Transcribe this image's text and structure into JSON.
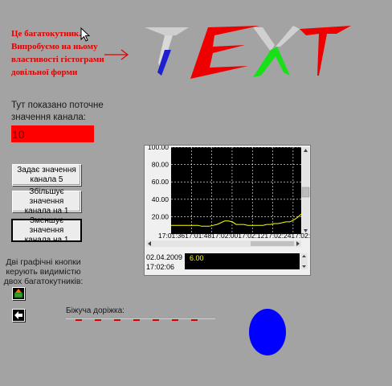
{
  "note": {
    "lines": [
      "Це багатокутник.",
      "Випробуємо на ньому",
      "властивості гістограми",
      "довільної форми"
    ],
    "color": "#e00000"
  },
  "current_value": {
    "label_lines": [
      "Тут показано поточне",
      "значення канала:"
    ],
    "value": "10"
  },
  "buttons": [
    {
      "lines": [
        "Задає значення",
        "канала 5"
      ]
    },
    {
      "lines": [
        "Збільшує значення",
        "канала на 1"
      ]
    },
    {
      "lines": [
        "Зменшує значення",
        "канала на 1"
      ]
    }
  ],
  "chart_data": {
    "type": "line",
    "y_ticks": [
      "100.00",
      "80.00",
      "60.00",
      "40.00",
      "20.00"
    ],
    "x_tick_text": "17:01:3617:01:4817:02:0017:02:1217:02:2417:02:0",
    "ylim": [
      0,
      100
    ],
    "grid": true,
    "background": "#000000",
    "series": [
      {
        "color": "#ffff00",
        "values": [
          10,
          10,
          10,
          10,
          10,
          10,
          10,
          10,
          9,
          9,
          9,
          10,
          11,
          13,
          15,
          15,
          14,
          11,
          11,
          11,
          10,
          10,
          10,
          10,
          10,
          11,
          11,
          12,
          12,
          13,
          14,
          14,
          16,
          19,
          23
        ]
      }
    ]
  },
  "info": {
    "date": "02.04.2009",
    "time": "17:02:06",
    "value": "6.00"
  },
  "graphic_buttons": {
    "label_lines": [
      "Дві графічні кнопки",
      "керують видимістю",
      "двох багатокутників:"
    ],
    "icons": [
      "green-arrow-up-icon",
      "arrow-left-icon"
    ]
  },
  "running_line": {
    "label": "Біжуча доріжка:"
  },
  "colors": {
    "background": "#a3a3a3",
    "value_box": "#ff0000",
    "ellipse": "#0000ff",
    "chart_line": "#ffff00"
  }
}
